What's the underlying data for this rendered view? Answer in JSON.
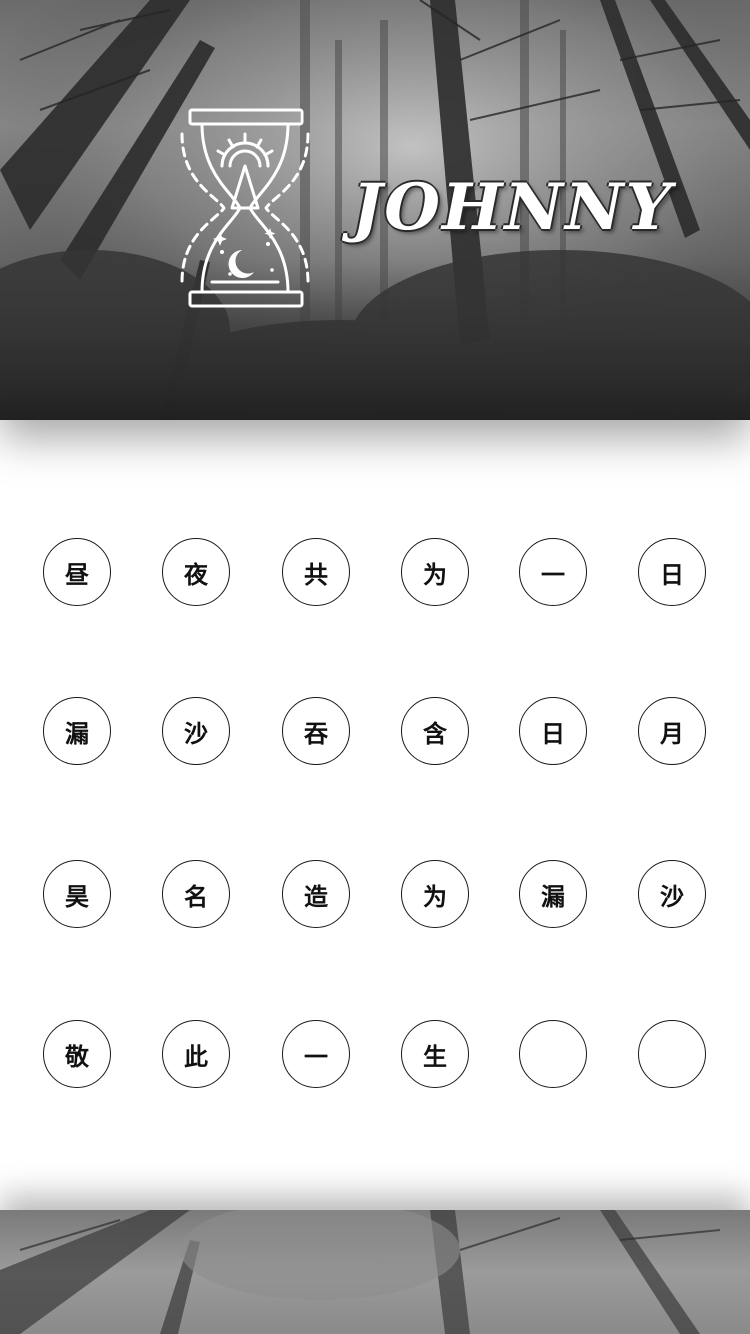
{
  "header": {
    "brand_name": "JOHNNY",
    "logo_icon": "hourglass-sun-moon-icon",
    "background": "misty-forest-photo"
  },
  "grid": {
    "rows": [
      [
        "昼",
        "夜",
        "共",
        "为",
        "一",
        "日"
      ],
      [
        "漏",
        "沙",
        "吞",
        "含",
        "日",
        "月"
      ],
      [
        "昊",
        "名",
        "造",
        "为",
        "漏",
        "沙"
      ],
      [
        "敬",
        "此",
        "一",
        "生",
        "",
        ""
      ]
    ]
  },
  "footer": {
    "background": "misty-forest-photo"
  },
  "colors": {
    "circle_border": "#1a1a1a",
    "text": "#111111",
    "page_background": "#ffffff"
  }
}
